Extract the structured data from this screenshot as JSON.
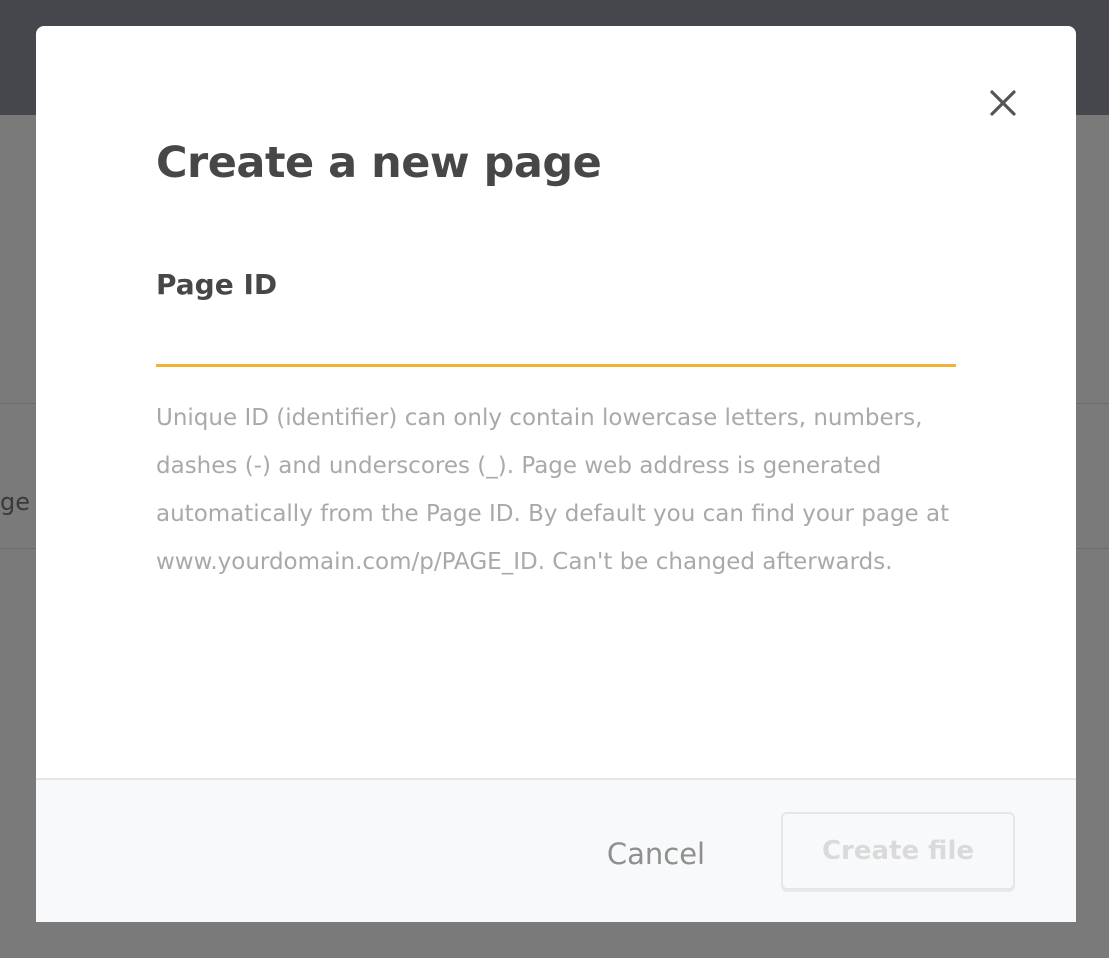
{
  "background": {
    "partial_text": "ge"
  },
  "modal": {
    "title": "Create a new page",
    "close_icon": "close-icon",
    "field": {
      "label": "Page ID",
      "value": "",
      "placeholder": ""
    },
    "help_text": "Unique ID (identifier) can only contain lowercase letters, numbers, dashes (-) and underscores (_). Page web address is generated automatically from the Page ID. By default you can find your page at www.yourdomain.com/p/PAGE_ID. Can't be changed afterwards.",
    "footer": {
      "cancel_label": "Cancel",
      "create_label": "Create file"
    }
  },
  "colors": {
    "accent": "#f2b234",
    "title_text": "#474747",
    "help_text": "#a9a9a9",
    "topbar": "#45474c",
    "overlay": "#7a7a7a"
  }
}
